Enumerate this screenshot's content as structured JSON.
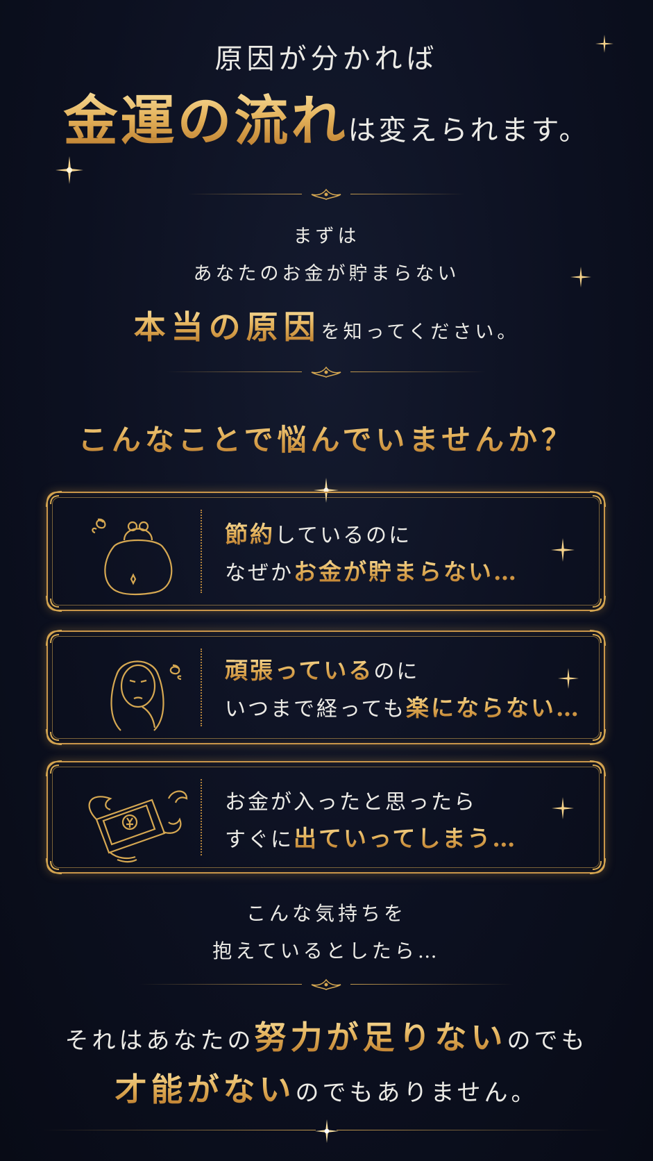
{
  "hero": {
    "line1": "原因が分かれば",
    "line2_gold": "金運の流れ",
    "line2_rest": "は変えられます。"
  },
  "intro": {
    "line1": "まずは",
    "line2": "あなたのお金が貯まらない",
    "line3_gold": "本当の原因",
    "line3_rest": "を知ってください。"
  },
  "question": "こんなことで悩んでいませんか？",
  "cards": [
    {
      "icon": "purse-icon",
      "l1_gold": "節約",
      "l1_rest": "しているのに",
      "l2_white": "なぜか",
      "l2_gold": "お金が貯まらない…"
    },
    {
      "icon": "worried-woman-icon",
      "l1_gold": "頑張っている",
      "l1_rest": "のに",
      "l2_white": "いつまで経っても",
      "l2_gold": "楽にならない…"
    },
    {
      "icon": "flying-money-icon",
      "l1_gold": "",
      "l1_rest": "お金が入ったと思ったら",
      "l2_white": "すぐに",
      "l2_gold": "出ていってしまう…"
    }
  ],
  "middle": {
    "line1": "こんな気持ちを",
    "line2": "抱えているとしたら…"
  },
  "final": {
    "l1_white_a": "それはあなたの",
    "l1_gold": "努力が足りない",
    "l1_white_b": "のでも",
    "l2_gold": "才能がない",
    "l2_white": "のでもありません。"
  },
  "colors": {
    "gold": "#d9a655",
    "background": "#0c1020",
    "text": "#ecebe6"
  }
}
